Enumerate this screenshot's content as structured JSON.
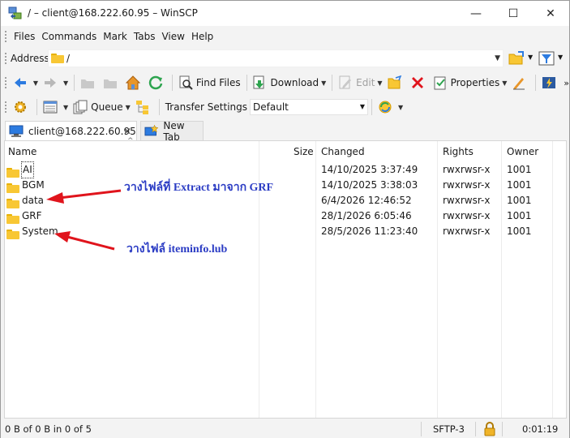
{
  "window": {
    "title": "/ – client@168.222.60.95 – WinSCP",
    "minimize_glyph": "—",
    "maximize_glyph": "☐",
    "close_glyph": "✕"
  },
  "menu": [
    "Files",
    "Commands",
    "Mark",
    "Tabs",
    "View",
    "Help"
  ],
  "address": {
    "label": "Address",
    "path": "/"
  },
  "toolbar1": {
    "find_files": "Find Files",
    "download": "Download",
    "edit": "Edit",
    "properties": "Properties"
  },
  "toolbar2": {
    "queue": "Queue",
    "transfer_settings_label": "Transfer Settings",
    "transfer_settings_value": "Default"
  },
  "tabs": {
    "session": "client@168.222.60.95",
    "new_tab": "New Tab"
  },
  "columns": [
    "Name",
    "Size",
    "Changed",
    "Rights",
    "Owner"
  ],
  "files": [
    {
      "name": "AI",
      "size": "",
      "changed": "14/10/2025 3:37:49",
      "rights": "rwxrwsr-x",
      "owner": "1001"
    },
    {
      "name": "BGM",
      "size": "",
      "changed": "14/10/2025 3:38:03",
      "rights": "rwxrwsr-x",
      "owner": "1001"
    },
    {
      "name": "data",
      "size": "",
      "changed": "6/4/2026 12:46:52",
      "rights": "rwxrwsr-x",
      "owner": "1001"
    },
    {
      "name": "GRF",
      "size": "",
      "changed": "28/1/2026 6:05:46",
      "rights": "rwxrwsr-x",
      "owner": "1001"
    },
    {
      "name": "System",
      "size": "",
      "changed": "28/5/2026 11:23:40",
      "rights": "rwxrwsr-x",
      "owner": "1001"
    }
  ],
  "annotations": {
    "data_note": "วางไฟล์ที่ Extract มาจาก GRF",
    "system_note": "วางไฟล์ iteminfo.lub",
    "color": "#2b3cc4",
    "arrow_color": "#e0141c"
  },
  "status": {
    "selection": "0 B of 0 B in 0 of 5",
    "protocol": "SFTP-3",
    "elapsed": "0:01:19"
  }
}
